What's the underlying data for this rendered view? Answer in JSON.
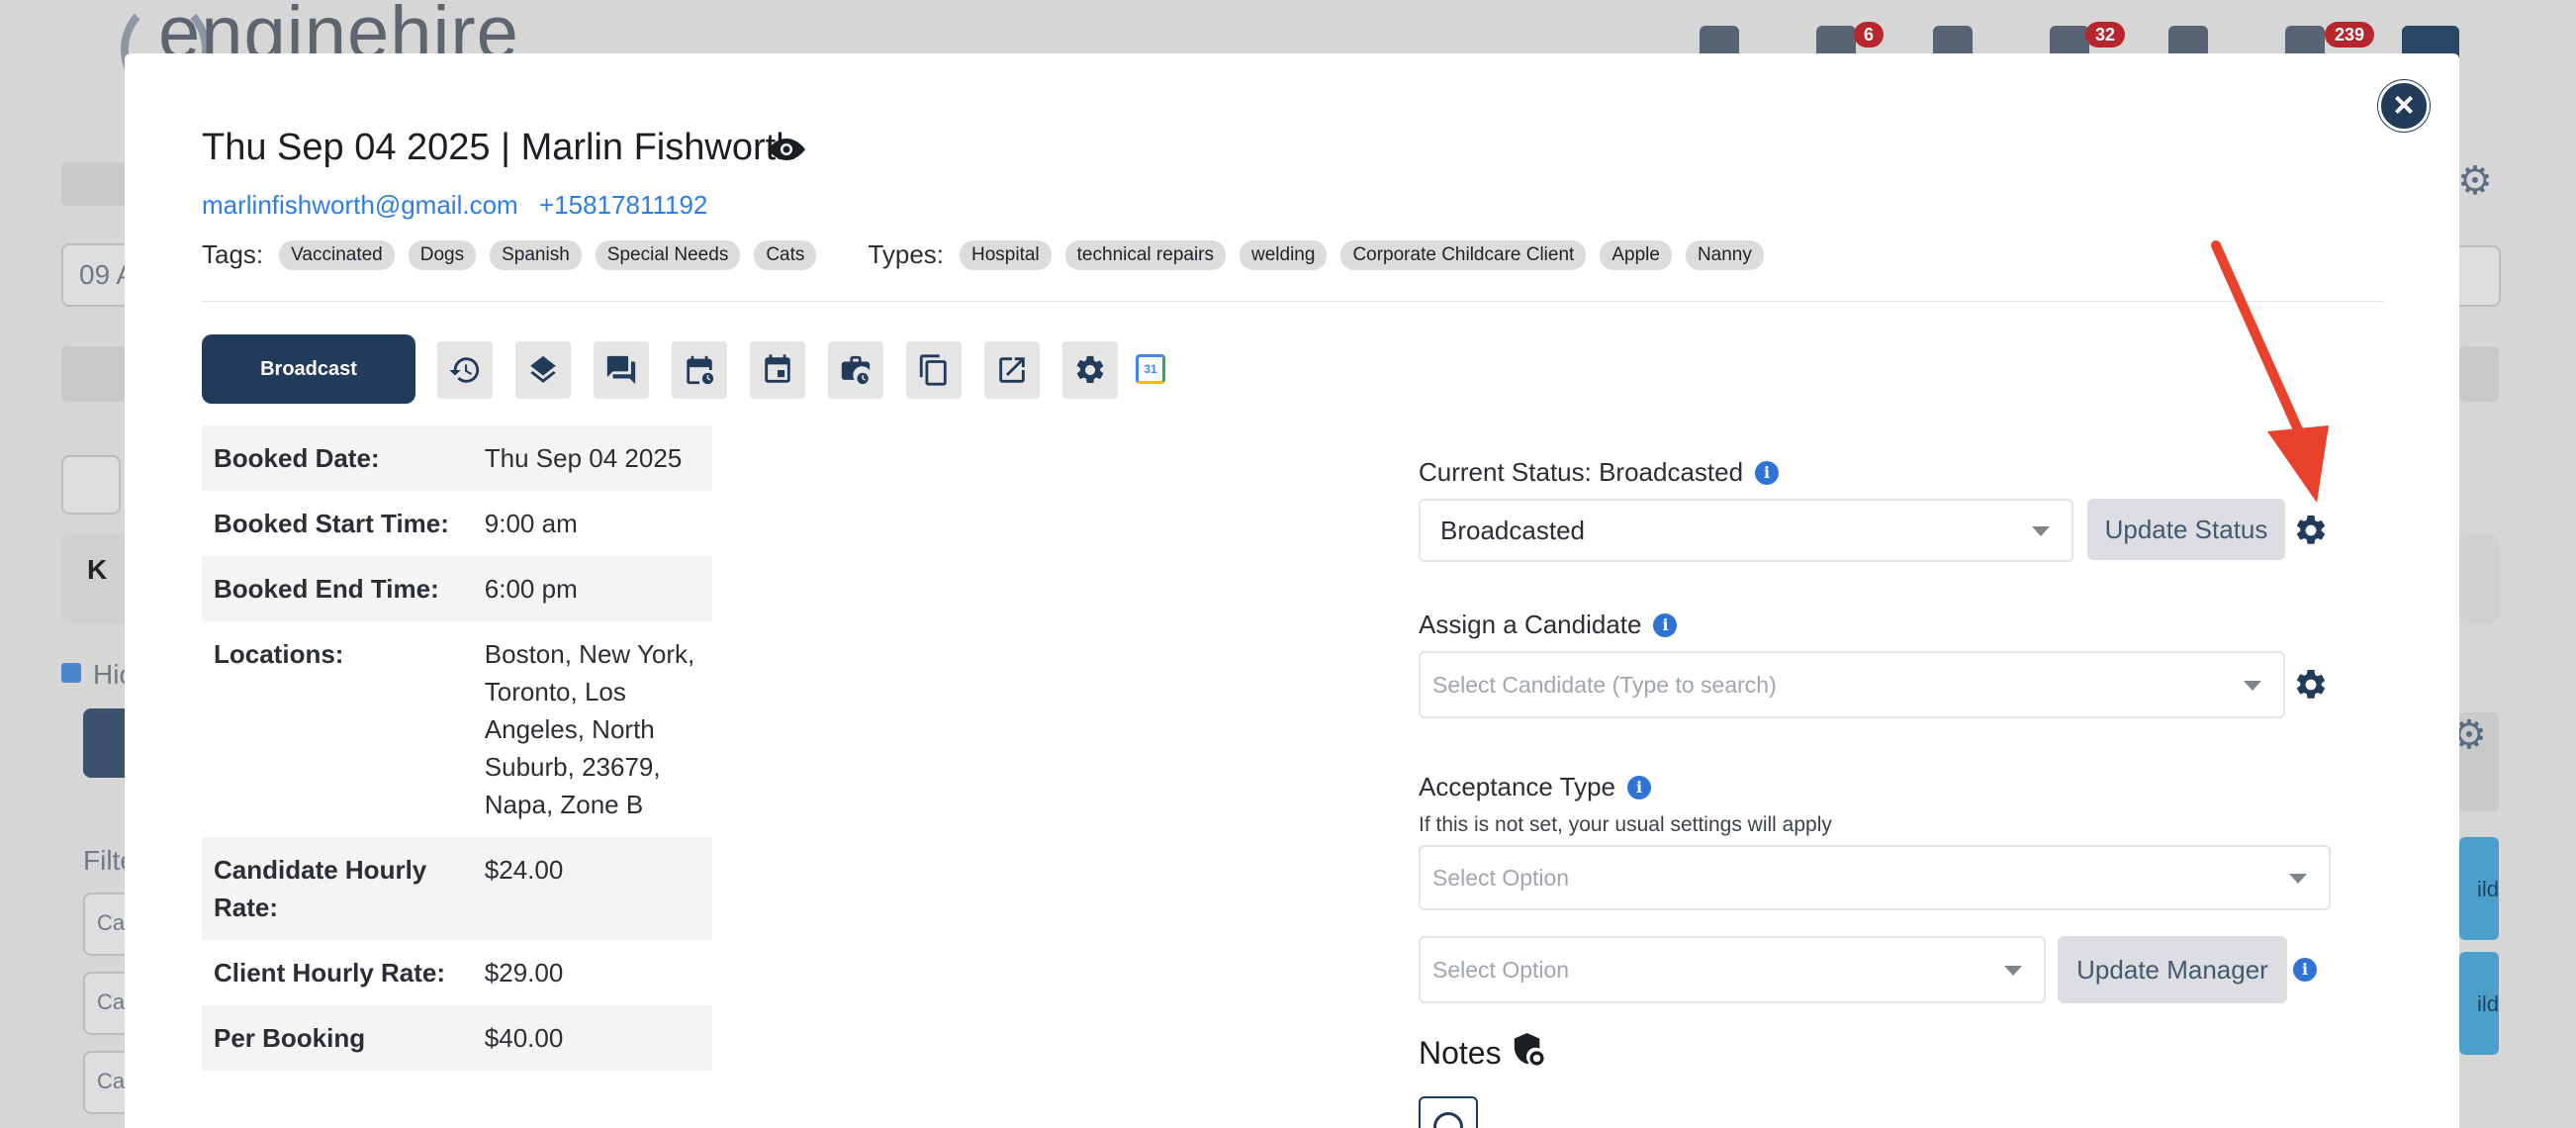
{
  "background": {
    "logo_text": "enginehire",
    "badges": [
      "6",
      "32",
      "239"
    ],
    "partial_input": "09 A",
    "partial_section": "K",
    "hide_label": "Hic",
    "filter_label": "Filte",
    "filter_placeholders": [
      "Ca",
      "Ca",
      "Ca"
    ],
    "card_text": [
      "ild",
      "ild"
    ]
  },
  "header": {
    "date": "Thu Sep 04 2025",
    "separator": "|",
    "client_name": "Marlin Fishworth",
    "email": "marlinfishworth@gmail.com",
    "phone": "+15817811192"
  },
  "tags": {
    "label": "Tags:",
    "items": [
      "Vaccinated",
      "Dogs",
      "Spanish",
      "Special Needs",
      "Cats"
    ]
  },
  "types": {
    "label": "Types:",
    "items": [
      "Hospital",
      "technical repairs",
      "welding",
      "Corporate Childcare Client",
      "Apple",
      "Nanny"
    ]
  },
  "toolbar": {
    "broadcast_label": "Broadcast",
    "gcal_text": "31"
  },
  "details": [
    {
      "label": "Booked Date:",
      "value": "Thu Sep 04 2025"
    },
    {
      "label": "Booked Start Time:",
      "value": "9:00 am"
    },
    {
      "label": "Booked End Time:",
      "value": "6:00 pm"
    },
    {
      "label": "Locations:",
      "value": "Boston, New York, Toronto, Los Angeles, North Suburb, 23679, Napa, Zone B"
    },
    {
      "label": "Candidate Hourly Rate:",
      "value": "$24.00"
    },
    {
      "label": "Client Hourly Rate:",
      "value": "$29.00"
    },
    {
      "label": "Per Booking",
      "value": "$40.00"
    }
  ],
  "status": {
    "label": "Current Status: Broadcasted",
    "selected": "Broadcasted",
    "update_button": "Update Status"
  },
  "candidate": {
    "label": "Assign a Candidate",
    "placeholder": "Select Candidate (Type to search)"
  },
  "acceptance": {
    "label": "Acceptance Type",
    "help": "If this is not set, your usual settings will apply",
    "placeholder": "Select Option"
  },
  "manager": {
    "placeholder": "Select Option",
    "update_button": "Update Manager"
  },
  "notes": {
    "title": "Notes"
  },
  "colors": {
    "primary": "#223b5a",
    "link": "#2f7de1",
    "info": "#2f73d6",
    "badge": "#b7262d",
    "arrow": "#e8412c"
  }
}
